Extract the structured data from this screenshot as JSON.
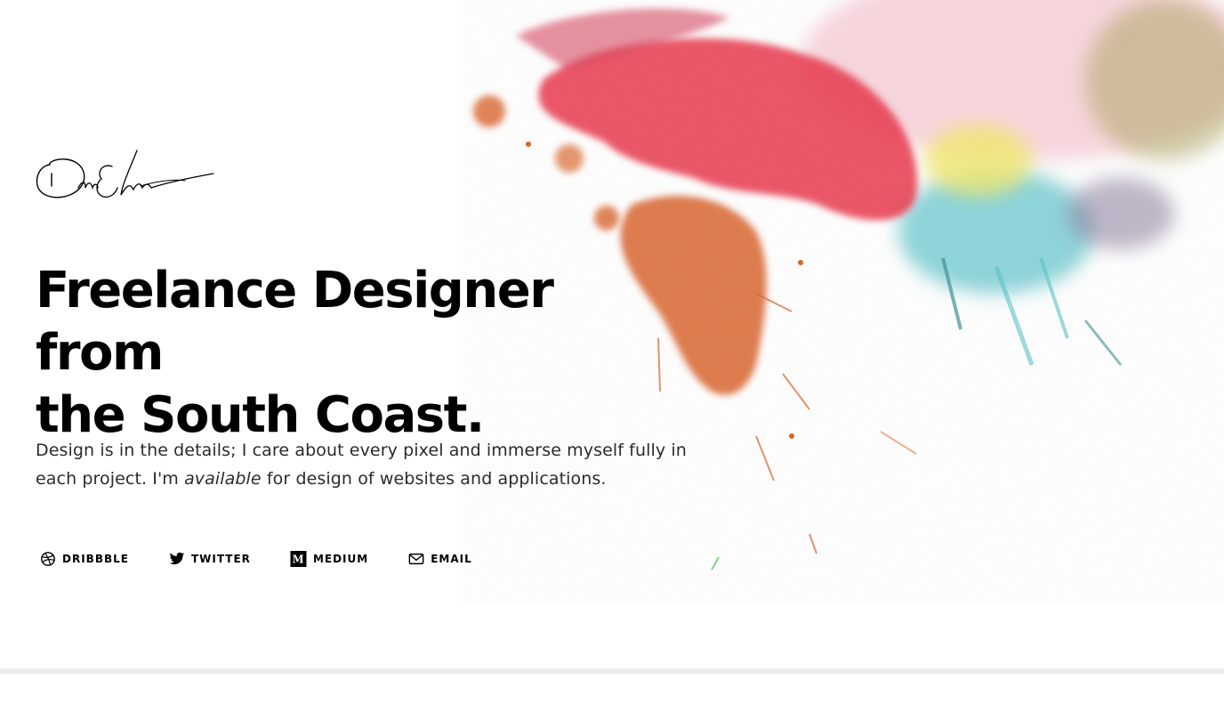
{
  "hero": {
    "signature_alt": "Dan Edwards signature",
    "headline_line1": "Freelance Designer from",
    "headline_line2": "the South Coast.",
    "intro_before": "Design is in the details; I care about every pixel and immerse myself fully in each project. I'm ",
    "intro_emphasis": "available",
    "intro_after": " for design of websites and applications."
  },
  "social": {
    "links": [
      {
        "label": "DRIBBBLE",
        "icon": "dribbble-icon"
      },
      {
        "label": "TWITTER",
        "icon": "twitter-icon"
      },
      {
        "label": "MEDIUM",
        "icon": "medium-icon"
      },
      {
        "label": "EMAIL",
        "icon": "email-icon"
      }
    ]
  },
  "colors": {
    "text": "#000000",
    "body_text": "#2b2b2b",
    "divider": "#ececec",
    "splash_red": "#e8344a",
    "splash_orange": "#d9622b",
    "splash_teal": "#5cc2c9",
    "splash_yellow": "#f2e86a",
    "splash_olive": "#a8a25a"
  }
}
